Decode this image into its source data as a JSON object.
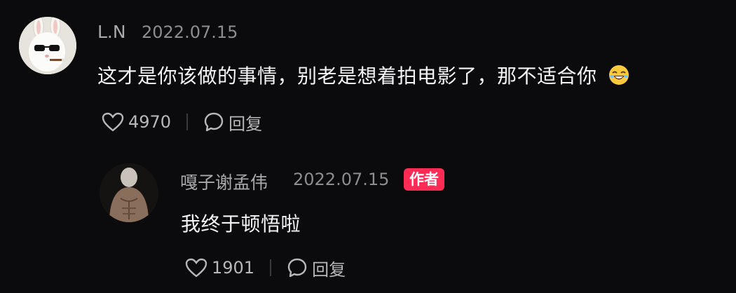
{
  "comments": [
    {
      "username": "L.N",
      "date": "2022.07.15",
      "text": "这才是你该做的事情，别老是想着拍电影了，那不适合你",
      "emoji": "rolling-on-floor-laughing",
      "likes": "4970",
      "reply_label": "回复"
    },
    {
      "username": "嘎子谢孟伟",
      "date": "2022.07.15",
      "badge": "作者",
      "text": "我终于顿悟啦",
      "likes": "1901",
      "reply_label": "回复"
    }
  ],
  "colors": {
    "background": "#0b0b0d",
    "badge": "#fe2c55",
    "username": "#a9a9ad",
    "text": "#f4f4f5"
  },
  "icons": [
    "heart-outline-icon",
    "speech-bubble-icon",
    "laughing-emoji"
  ]
}
